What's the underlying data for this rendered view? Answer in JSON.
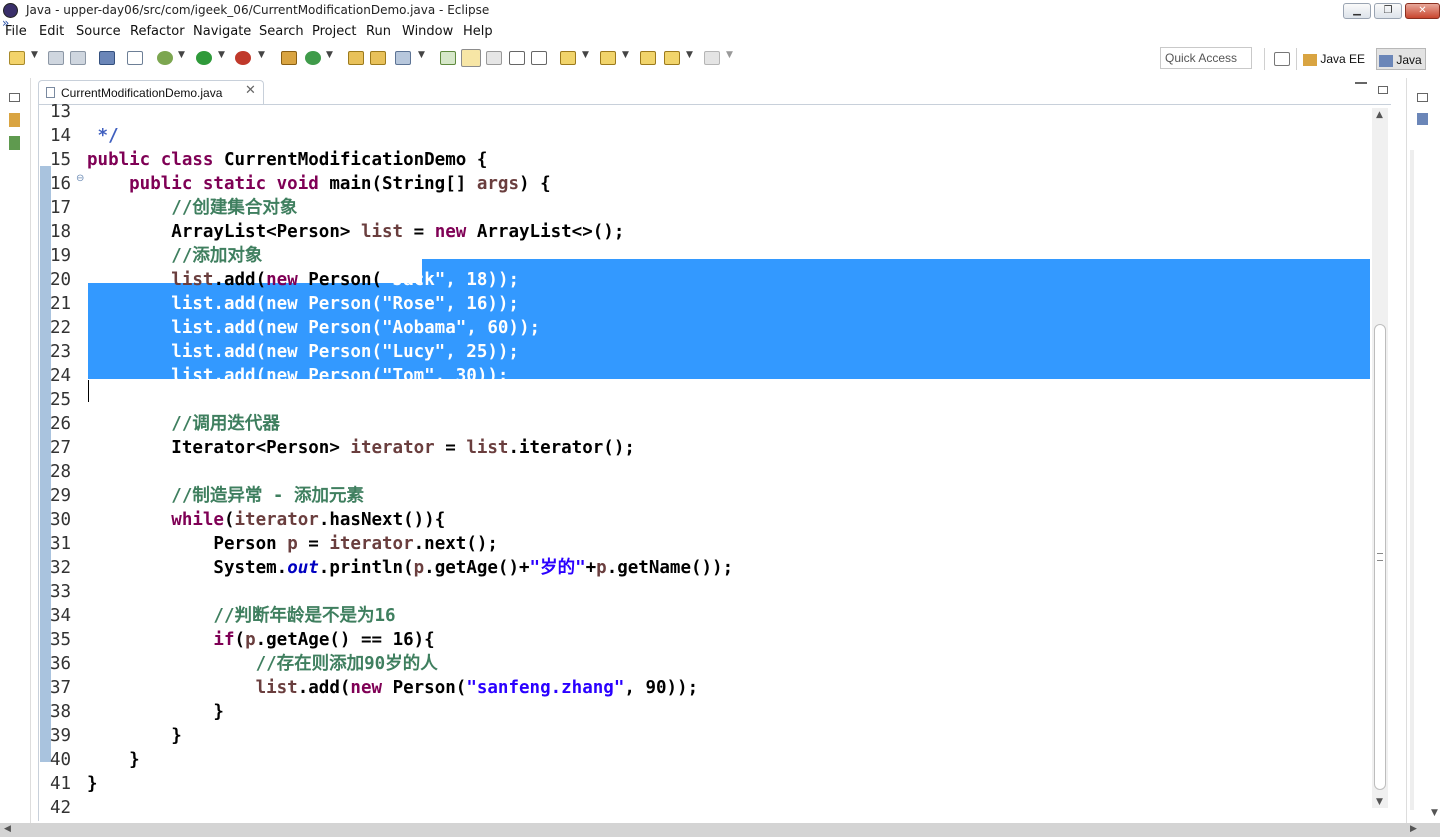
{
  "window": {
    "title": "Java - upper-day06/src/com/igeek_06/CurrentModificationDemo.java - Eclipse",
    "minimize": "▁",
    "restore": "❐",
    "close": "✕"
  },
  "menu": [
    "File",
    "Edit",
    "Source",
    "Refactor",
    "Navigate",
    "Search",
    "Project",
    "Run",
    "Window",
    "Help"
  ],
  "toolbar": {
    "quick_access_placeholder": "Quick Access",
    "perspectives": [
      "Java EE",
      "Java"
    ],
    "icons": [
      "new-icon",
      "save-icon",
      "save-all-icon",
      "print-icon",
      "skip-breakpoints-icon",
      "debug-icon",
      "run-icon",
      "external-tools-icon",
      "new-java-package-icon",
      "new-java-class-icon",
      "open-type-icon",
      "open-task-icon",
      "search-icon",
      "toggle-mark-occurrences-icon",
      "toggle-block-selection-icon",
      "show-whitespace-icon",
      "next-annotation-icon",
      "previous-annotation-icon",
      "last-edit-location-icon",
      "back-icon",
      "forward-icon"
    ]
  },
  "editor": {
    "tab_label": "CurrentModificationDemo.java",
    "tab_close": "✕",
    "lines": [
      {
        "n": "13",
        "segs": [
          {
            "t": "",
            "c": "#000"
          }
        ]
      },
      {
        "n": "14",
        "segs": [
          {
            "t": " */",
            "c": "#3f5fbf"
          }
        ]
      },
      {
        "n": "15",
        "segs": [
          {
            "t": "public class ",
            "c": "#7f0055"
          },
          {
            "t": "CurrentModificationDemo {",
            "c": "#000"
          }
        ]
      },
      {
        "n": "16",
        "fold": true,
        "segs": [
          {
            "t": "    public static void ",
            "c": "#7f0055"
          },
          {
            "t": "main(String[] ",
            "c": "#000"
          },
          {
            "t": "args",
            "c": "#6a3e3e"
          },
          {
            "t": ") {",
            "c": "#000"
          }
        ]
      },
      {
        "n": "17",
        "segs": [
          {
            "t": "        //创建集合对象",
            "c": "#3f7f5f"
          }
        ]
      },
      {
        "n": "18",
        "segs": [
          {
            "t": "        ArrayList<Person> ",
            "c": "#000"
          },
          {
            "t": "list",
            "c": "#6a3e3e"
          },
          {
            "t": " = ",
            "c": "#000"
          },
          {
            "t": "new",
            "c": "#7f0055"
          },
          {
            "t": " ArrayList<>();",
            "c": "#000"
          }
        ]
      },
      {
        "n": "19",
        "segs": [
          {
            "t": "        //添加对象",
            "c": "#3f7f5f"
          }
        ]
      },
      {
        "n": "20",
        "segs": [
          {
            "t": "        ",
            "c": "#000"
          },
          {
            "t": "list",
            "c": "#6a3e3e"
          },
          {
            "t": ".add(",
            "c": "#000"
          },
          {
            "t": "new",
            "c": "#7f0055"
          },
          {
            "t": " Person(",
            "c": "#000"
          },
          {
            "t": "\"Jack\", 18));",
            "c": "#fff"
          }
        ]
      },
      {
        "n": "21",
        "segs": [
          {
            "t": "        list.add(new Person(\"Rose\", 16));",
            "c": "#fff"
          }
        ]
      },
      {
        "n": "22",
        "segs": [
          {
            "t": "        list.add(new Person(\"Aobama\", 60));",
            "c": "#fff"
          }
        ]
      },
      {
        "n": "23",
        "segs": [
          {
            "t": "        list.add(new Person(\"Lucy\", 25));",
            "c": "#fff"
          }
        ]
      },
      {
        "n": "24",
        "segs": [
          {
            "t": "        list.add(new Person(\"Tom\", 30));",
            "c": "#fff"
          }
        ]
      },
      {
        "n": "25",
        "segs": [
          {
            "t": "",
            "c": "#000"
          }
        ]
      },
      {
        "n": "26",
        "segs": [
          {
            "t": "        //调用迭代器",
            "c": "#3f7f5f"
          }
        ]
      },
      {
        "n": "27",
        "segs": [
          {
            "t": "        Iterator<Person> ",
            "c": "#000"
          },
          {
            "t": "iterator",
            "c": "#6a3e3e"
          },
          {
            "t": " = ",
            "c": "#000"
          },
          {
            "t": "list",
            "c": "#6a3e3e"
          },
          {
            "t": ".iterator();",
            "c": "#000"
          }
        ]
      },
      {
        "n": "28",
        "segs": [
          {
            "t": "",
            "c": "#000"
          }
        ]
      },
      {
        "n": "29",
        "segs": [
          {
            "t": "        //制造异常 - 添加元素",
            "c": "#3f7f5f"
          }
        ]
      },
      {
        "n": "30",
        "segs": [
          {
            "t": "        while",
            "c": "#7f0055"
          },
          {
            "t": "(",
            "c": "#000"
          },
          {
            "t": "iterator",
            "c": "#6a3e3e"
          },
          {
            "t": ".hasNext()){",
            "c": "#000"
          }
        ]
      },
      {
        "n": "31",
        "segs": [
          {
            "t": "            Person ",
            "c": "#000"
          },
          {
            "t": "p",
            "c": "#6a3e3e"
          },
          {
            "t": " = ",
            "c": "#000"
          },
          {
            "t": "iterator",
            "c": "#6a3e3e"
          },
          {
            "t": ".next();",
            "c": "#000"
          }
        ]
      },
      {
        "n": "32",
        "segs": [
          {
            "t": "            System.",
            "c": "#000"
          },
          {
            "t": "out",
            "c": "#0000c0",
            "i": true
          },
          {
            "t": ".println(",
            "c": "#000"
          },
          {
            "t": "p",
            "c": "#6a3e3e"
          },
          {
            "t": ".getAge()+",
            "c": "#000"
          },
          {
            "t": "\"岁的\"",
            "c": "#2a00ff"
          },
          {
            "t": "+",
            "c": "#000"
          },
          {
            "t": "p",
            "c": "#6a3e3e"
          },
          {
            "t": ".getName());",
            "c": "#000"
          }
        ]
      },
      {
        "n": "33",
        "segs": [
          {
            "t": "",
            "c": "#000"
          }
        ]
      },
      {
        "n": "34",
        "segs": [
          {
            "t": "            //判断年龄是不是为16",
            "c": "#3f7f5f"
          }
        ]
      },
      {
        "n": "35",
        "segs": [
          {
            "t": "            if",
            "c": "#7f0055"
          },
          {
            "t": "(",
            "c": "#000"
          },
          {
            "t": "p",
            "c": "#6a3e3e"
          },
          {
            "t": ".getAge() == 16){",
            "c": "#000"
          }
        ]
      },
      {
        "n": "36",
        "segs": [
          {
            "t": "                //存在则添加90岁的人",
            "c": "#3f7f5f"
          }
        ]
      },
      {
        "n": "37",
        "segs": [
          {
            "t": "                ",
            "c": "#000"
          },
          {
            "t": "list",
            "c": "#6a3e3e"
          },
          {
            "t": ".add(",
            "c": "#000"
          },
          {
            "t": "new",
            "c": "#7f0055"
          },
          {
            "t": " Person(",
            "c": "#000"
          },
          {
            "t": "\"sanfeng.zhang\"",
            "c": "#2a00ff"
          },
          {
            "t": ", 90));",
            "c": "#000"
          }
        ]
      },
      {
        "n": "38",
        "segs": [
          {
            "t": "            }",
            "c": "#000"
          }
        ]
      },
      {
        "n": "39",
        "segs": [
          {
            "t": "        }",
            "c": "#000"
          }
        ]
      },
      {
        "n": "40",
        "segs": [
          {
            "t": "    }",
            "c": "#000"
          }
        ]
      },
      {
        "n": "41",
        "segs": [
          {
            "t": "}",
            "c": "#000"
          }
        ]
      },
      {
        "n": "42",
        "segs": [
          {
            "t": "",
            "c": "#000"
          }
        ]
      }
    ]
  }
}
